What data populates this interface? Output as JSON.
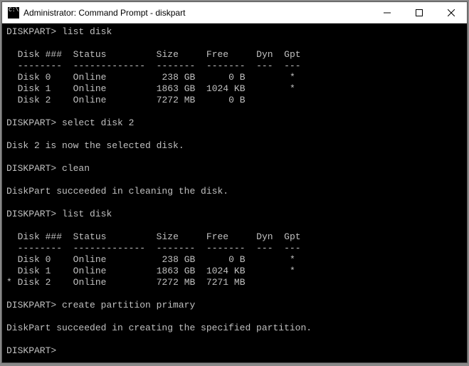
{
  "window": {
    "title": "Administrator: Command Prompt - diskpart",
    "icon_text": "C:\\."
  },
  "prompt": "DISKPART>",
  "header": {
    "disk": "Disk ###",
    "status": "Status",
    "size": "Size",
    "free": "Free",
    "dyn": "Dyn",
    "gpt": "Gpt",
    "sep_disk": "--------",
    "sep_status": "-------------",
    "sep_size": "-------",
    "sep_free": "-------",
    "sep_dyn": "---",
    "sep_gpt": "---"
  },
  "cmds": {
    "list_disk": "list disk",
    "select_disk_2": "select disk 2",
    "clean": "clean",
    "create_partition_primary": "create partition primary"
  },
  "msgs": {
    "selected": "Disk 2 is now the selected disk.",
    "cleaned": "DiskPart succeeded in cleaning the disk.",
    "partition_created": "DiskPart succeeded in creating the specified partition."
  },
  "table1": [
    {
      "sel": " ",
      "disk": "Disk 0",
      "status": "Online",
      "size": "238 GB",
      "free": "0 B",
      "dyn": "",
      "gpt": "*"
    },
    {
      "sel": " ",
      "disk": "Disk 1",
      "status": "Online",
      "size": "1863 GB",
      "free": "1024 KB",
      "dyn": "",
      "gpt": "*"
    },
    {
      "sel": " ",
      "disk": "Disk 2",
      "status": "Online",
      "size": "7272 MB",
      "free": "0 B",
      "dyn": "",
      "gpt": ""
    }
  ],
  "table2": [
    {
      "sel": " ",
      "disk": "Disk 0",
      "status": "Online",
      "size": "238 GB",
      "free": "0 B",
      "dyn": "",
      "gpt": "*"
    },
    {
      "sel": " ",
      "disk": "Disk 1",
      "status": "Online",
      "size": "1863 GB",
      "free": "1024 KB",
      "dyn": "",
      "gpt": "*"
    },
    {
      "sel": "*",
      "disk": "Disk 2",
      "status": "Online",
      "size": "7272 MB",
      "free": "7271 MB",
      "dyn": "",
      "gpt": ""
    }
  ]
}
